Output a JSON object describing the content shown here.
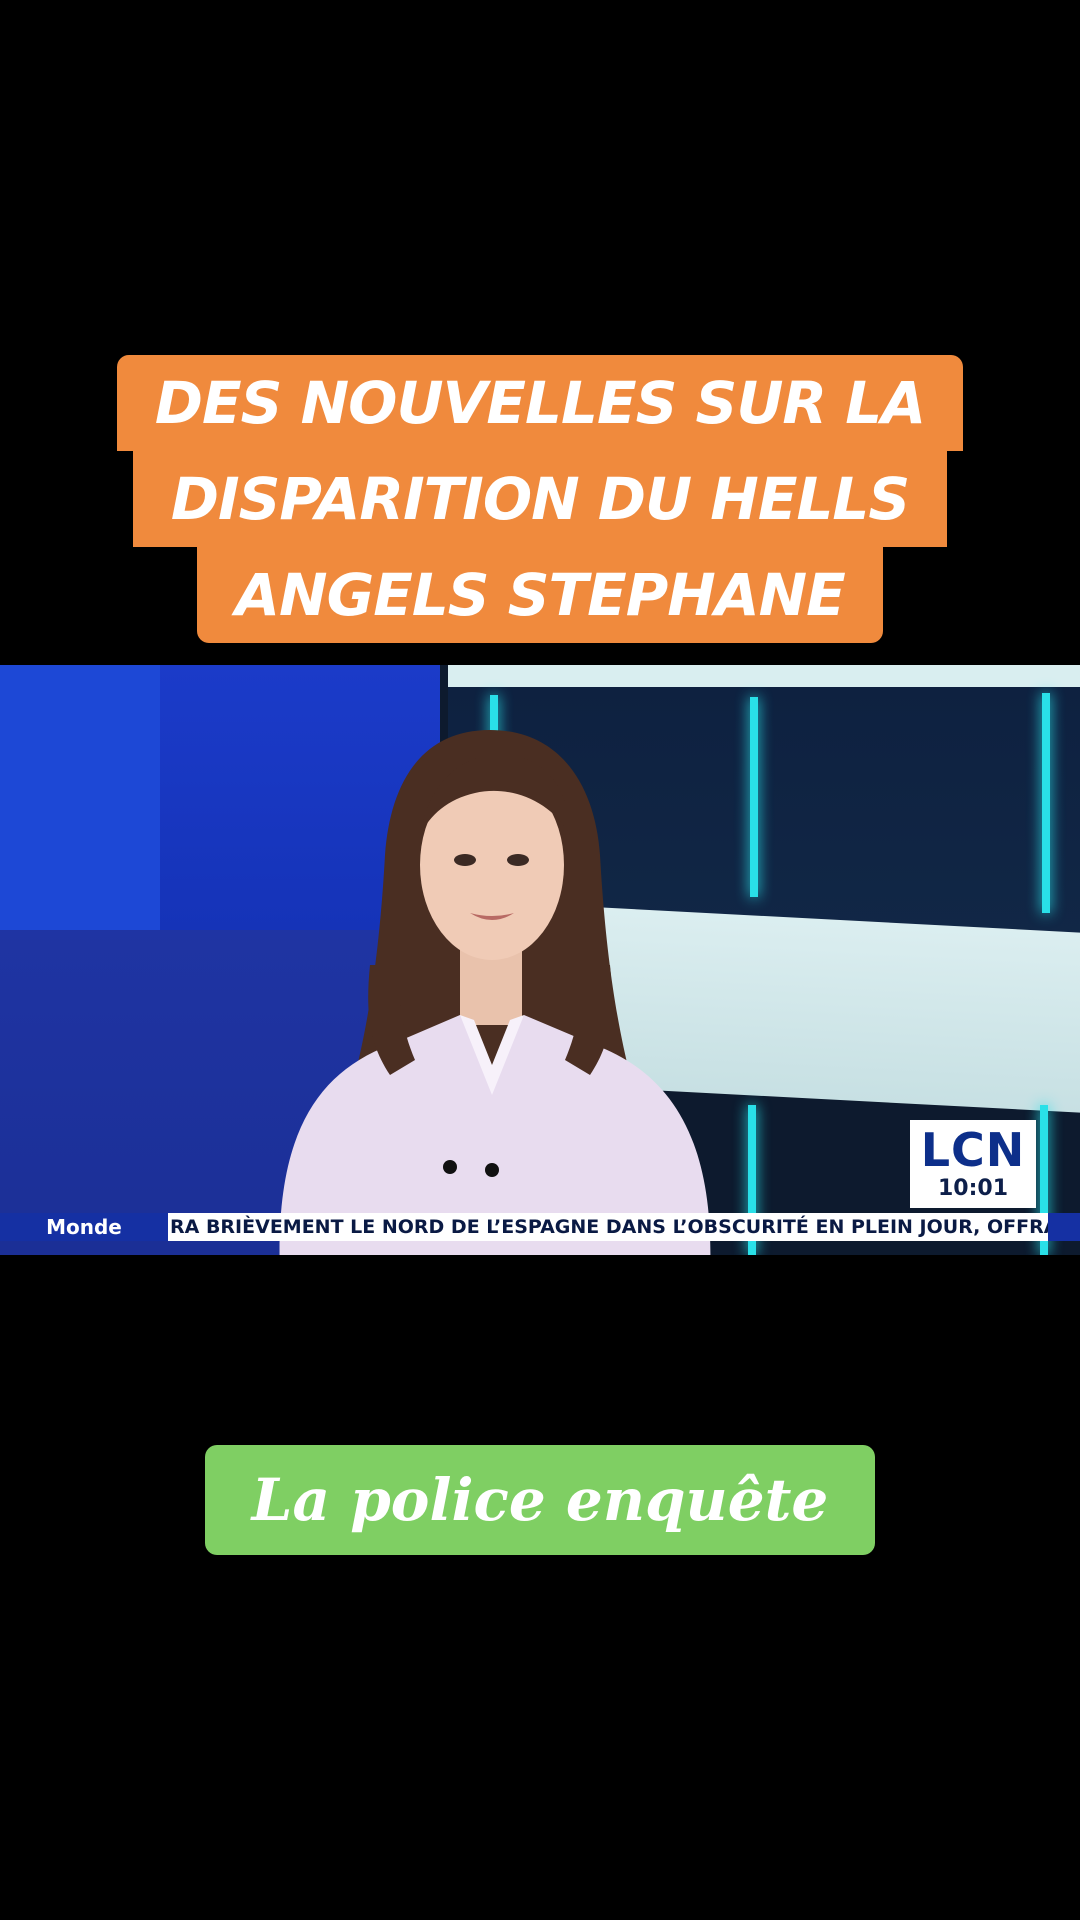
{
  "title_caption": {
    "lines": [
      "DES NOUVELLES SUR LA",
      "DISPARITION DU HELLS",
      "ANGELS STEPHANE"
    ],
    "background_color": "#f08a3d"
  },
  "broadcast": {
    "logo": "LCN",
    "time": "10:01",
    "ticker_label": "Monde",
    "ticker_text": "RA BRIÈVEMENT LE NORD DE L’ESPAGNE DANS L’OBSCURITÉ EN PLEIN JOUR, OFFRANT À DES"
  },
  "sub_caption": {
    "text": "La police enquête",
    "background_color": "#7fcf63"
  }
}
